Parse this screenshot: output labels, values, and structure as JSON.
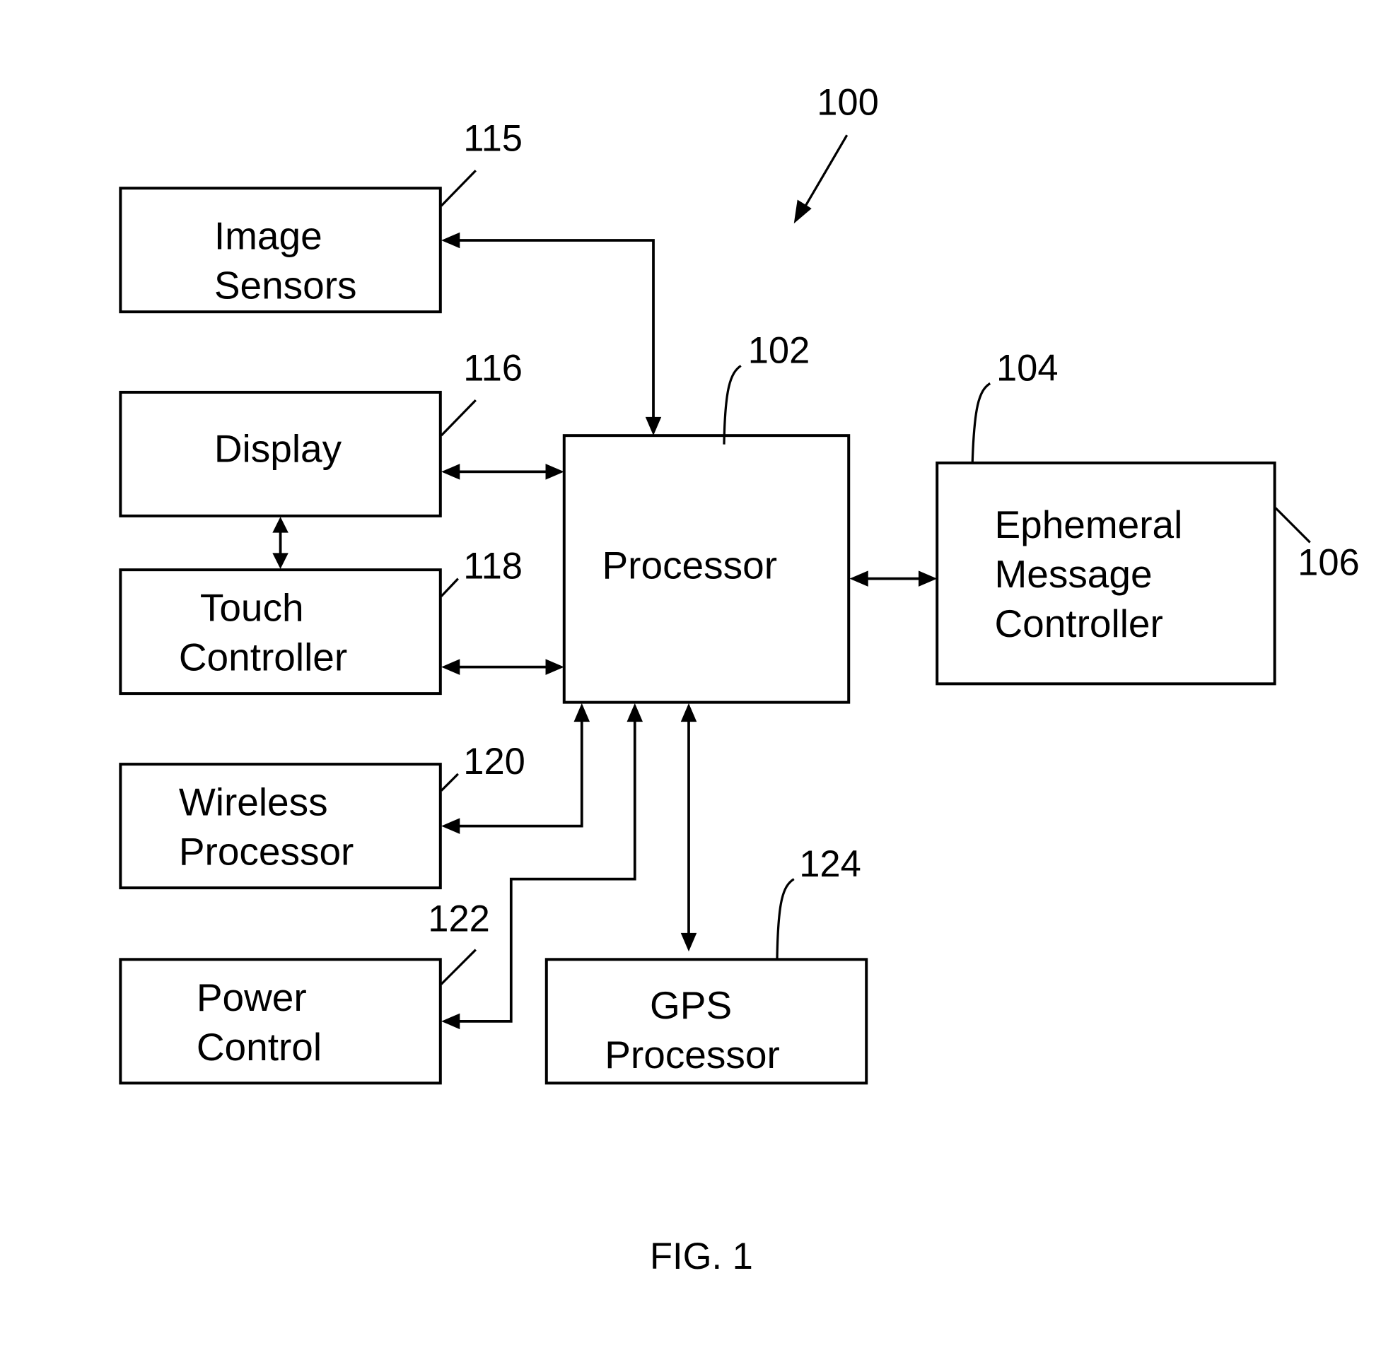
{
  "figure": {
    "caption": "FIG. 1",
    "system_ref": "100"
  },
  "blocks": {
    "image_sensors": {
      "ref": "115",
      "lines": [
        "Image",
        "Sensors"
      ]
    },
    "display": {
      "ref": "116",
      "lines": [
        "Display"
      ]
    },
    "touch_controller": {
      "ref": "118",
      "lines": [
        "Touch",
        "Controller"
      ]
    },
    "wireless_processor": {
      "ref": "120",
      "lines": [
        "Wireless",
        "Processor"
      ]
    },
    "power_control": {
      "ref": "122",
      "lines": [
        "Power",
        "Control"
      ]
    },
    "processor": {
      "ref": "102",
      "lines": [
        "Processor"
      ]
    },
    "ephemeral_message_controller": {
      "ref": "104",
      "ref2": "106",
      "lines": [
        "Ephemeral",
        "Message",
        "Controller"
      ]
    },
    "gps_processor": {
      "ref": "124",
      "lines": [
        "GPS",
        "Processor"
      ]
    }
  },
  "connections": [
    {
      "from": "processor",
      "to": "image_sensors",
      "direction": "bidirectional"
    },
    {
      "from": "processor",
      "to": "display",
      "direction": "bidirectional"
    },
    {
      "from": "display",
      "to": "touch_controller",
      "direction": "bidirectional"
    },
    {
      "from": "processor",
      "to": "touch_controller",
      "direction": "bidirectional"
    },
    {
      "from": "processor",
      "to": "wireless_processor",
      "direction": "bidirectional"
    },
    {
      "from": "processor",
      "to": "power_control",
      "direction": "bidirectional"
    },
    {
      "from": "processor",
      "to": "gps_processor",
      "direction": "bidirectional"
    },
    {
      "from": "processor",
      "to": "ephemeral_message_controller",
      "direction": "bidirectional"
    }
  ]
}
